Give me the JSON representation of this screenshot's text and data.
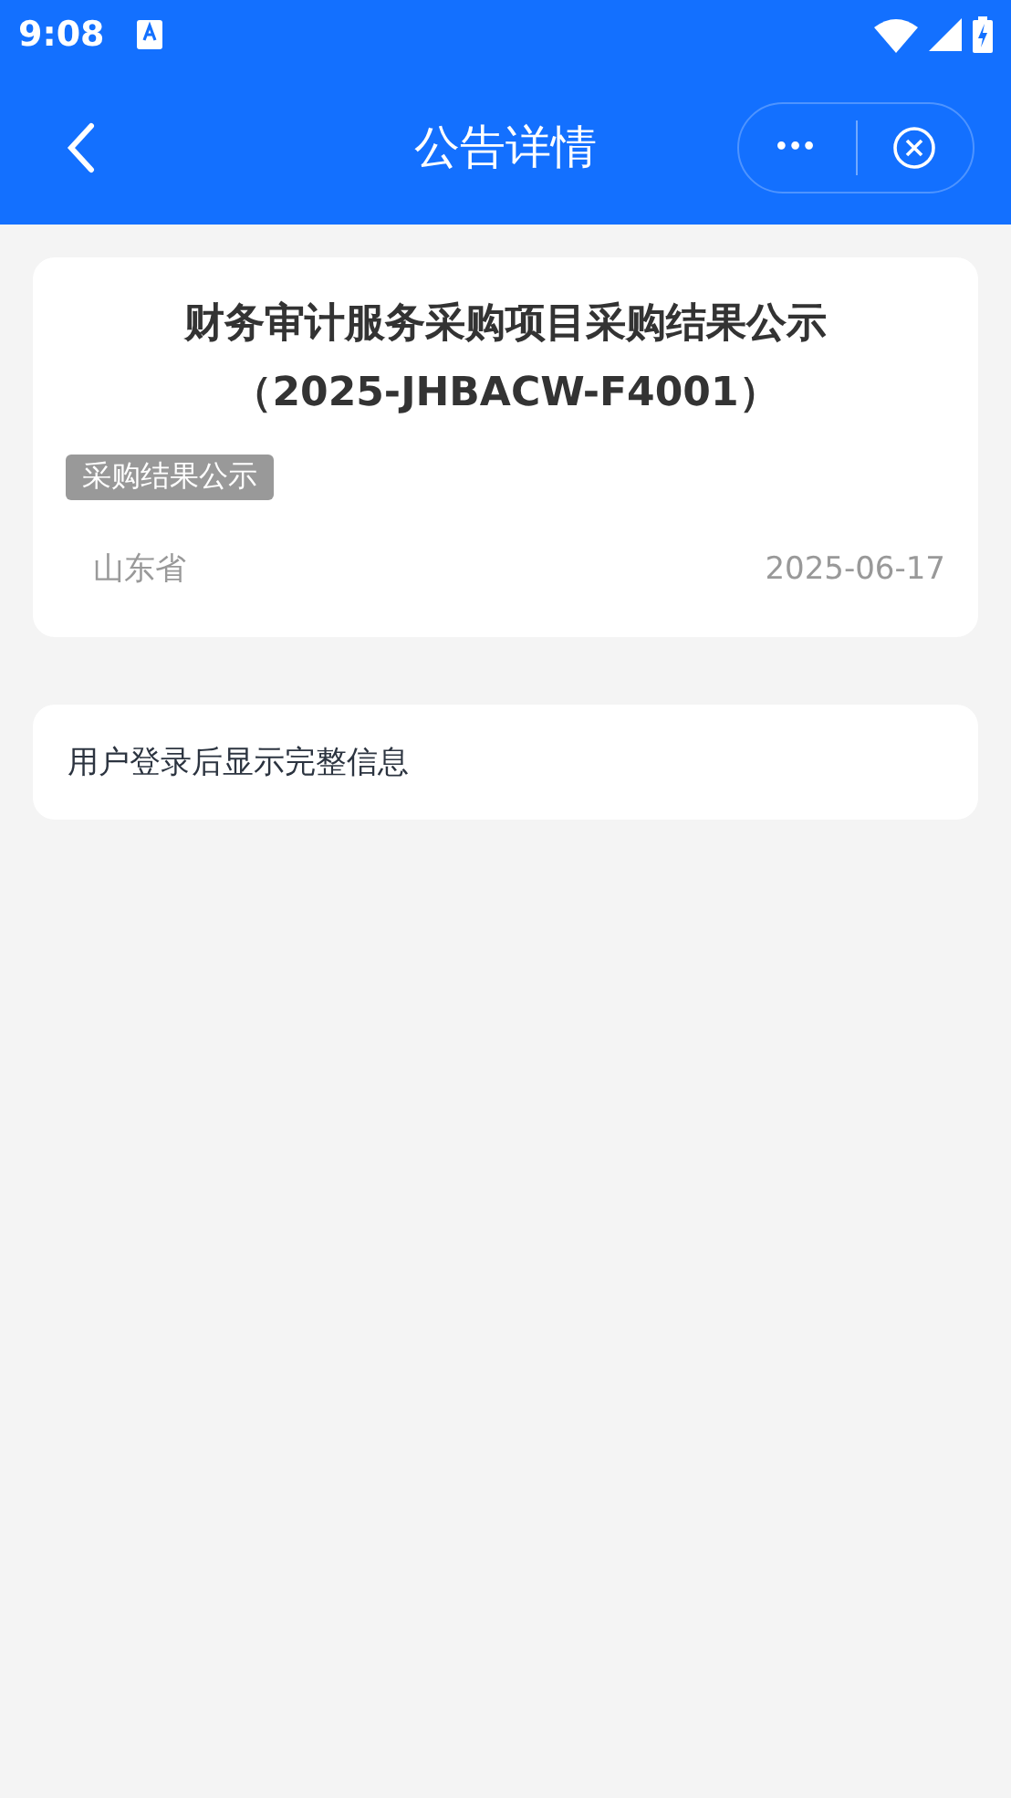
{
  "status_bar": {
    "time": "9:08"
  },
  "nav": {
    "title": "公告详情",
    "more": "•••"
  },
  "notice": {
    "title": "财务审计服务采购项目采购结果公示（2025-JHBACW-F4001）",
    "tag": "采购结果公示",
    "region": "山东省",
    "date": "2025-06-17"
  },
  "info": {
    "text": "用户登录后显示完整信息"
  }
}
